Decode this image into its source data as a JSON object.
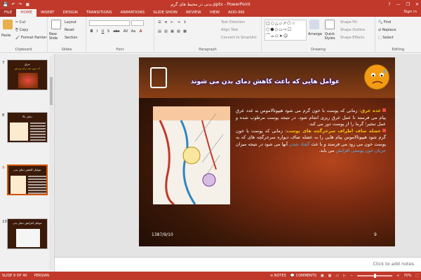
{
  "window": {
    "title": "بدنی در محیط های گرم.pptx - PowerPoint",
    "help": "?",
    "controls": [
      "—",
      "❐",
      "✕"
    ]
  },
  "quick_access": [
    "💾",
    "↶",
    "↷",
    "▣"
  ],
  "tabs": [
    {
      "label": "FILE"
    },
    {
      "label": "HOME"
    },
    {
      "label": "INSERT"
    },
    {
      "label": "DESIGN"
    },
    {
      "label": "TRANSITIONS"
    },
    {
      "label": "ANIMATIONS"
    },
    {
      "label": "SLIDE SHOW"
    },
    {
      "label": "REVIEW"
    },
    {
      "label": "VIEW"
    },
    {
      "label": "ADD-INS"
    }
  ],
  "signin": "Sign in",
  "ribbon": {
    "clipboard": {
      "label": "Clipboard",
      "paste": "Paste",
      "cut": "Cut",
      "copy": "Copy",
      "format_painter": "Format Painter"
    },
    "slides": {
      "label": "Slides",
      "new_slide": "New Slide",
      "layout": "Layout",
      "reset": "Reset",
      "section": "Section"
    },
    "font": {
      "label": "Font",
      "bold": "B",
      "italic": "I",
      "underline": "U",
      "shadow": "S",
      "strike": "abc",
      "spacing": "AV",
      "case": "Aa",
      "color": "A"
    },
    "paragraph": {
      "label": "Paragraph",
      "text_direction": "Text Direction",
      "align_text": "Align Text",
      "convert_smartart": "Convert to SmartArt"
    },
    "drawing": {
      "label": "Drawing",
      "arrange": "Arrange",
      "quick_styles": "Quick Styles",
      "shape_fill": "Shape Fill",
      "shape_outline": "Shape Outline",
      "shape_effects": "Shape Effects"
    },
    "editing": {
      "label": "Editing",
      "find": "Find",
      "replace": "Replace",
      "select": "Select"
    }
  },
  "thumbnails": [
    {
      "num": "7",
      "title": "عرق",
      "subtitle": "آب مورد نیاز برای ورزش"
    },
    {
      "num": "8",
      "title": "دمای بالا",
      "subtitle": ""
    },
    {
      "num": "9",
      "title": "عوامل کاهش دمای بدن",
      "subtitle": ""
    },
    {
      "num": "10",
      "title": "عوامل افزایش دمای بدن",
      "subtitle": ""
    }
  ],
  "slide": {
    "title": "عوامل هایی که باعث کاهش دمای بدن می شوند",
    "p1_head": "غده عرق",
    "p1_text": ": زمانی که پوست با خون گرم می شود هیپوتالاموس به غدد عرق پیام می فرستد تا عمل عرق ریزی انجام شود. در نتیجه پوست مرطوب شده و عمل تبخیر؛ گرما را از پوست دور می کند.",
    "p2_head": "عضله صاف اطراف سرخرگچه های پوست",
    "p2_text1": ": زمانی که پوست با خون گرم شود هیپوتالاموس پیام هایی را به عضله صاف دیواره سرخرگچه های که به پوست خون می رود می فرستد و با عث",
    "p2_hl1": "گشاد شدن",
    "p2_text2": "آنها می شود در نتیجه میزان",
    "p2_hl2": "جریان خون پوستی افزایش",
    "p2_text3": "می یابد.",
    "date": "1387/9/10",
    "number": "9"
  },
  "notes_placeholder": "Click to add notes",
  "status": {
    "slide_info": "SLIDE 9 OF 40",
    "language": "PERSIAN",
    "notes": "NOTES",
    "comments": "COMMENTS",
    "zoom": "70%"
  },
  "colors": {
    "accent": "#c0392b",
    "ribbon": "#f3f3f3",
    "highlight_yellow": "#f1c40f",
    "highlight_blue": "#5dade2"
  }
}
